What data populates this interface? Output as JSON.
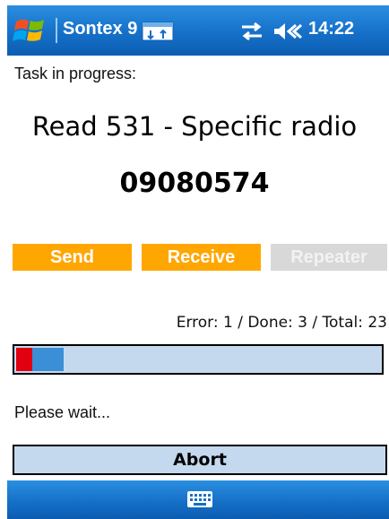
{
  "titlebar": {
    "start_icon": "windows-flag-icon",
    "app_title": "Sontex 9",
    "task_icon": "taskbar-window-icon",
    "connectivity_icon": "connectivity-arrows-icon",
    "volume_icon": "speaker-muted-icon",
    "time": "14:22"
  },
  "main": {
    "task_label": "Task in progress:",
    "task_title": "Read 531 - Specific radio",
    "task_number": "09080574",
    "buttons": {
      "send": "Send",
      "receive": "Receive",
      "repeater": "Repeater"
    },
    "counts_text": "Error: 1 / Done: 3 / Total: 23",
    "wait_text": "Please wait...",
    "abort_label": "Abort"
  },
  "progress": {
    "error": 1,
    "done": 3,
    "total": 23
  },
  "bottombar": {
    "keyboard_icon": "keyboard-icon"
  },
  "colors": {
    "titlebar_blue": "#1670c8",
    "action_orange": "#ffa600",
    "disabled_gray": "#d8d8d8",
    "progress_bg": "#c5d9ee",
    "error_red": "#e00010",
    "done_blue": "#3a8fd6"
  }
}
